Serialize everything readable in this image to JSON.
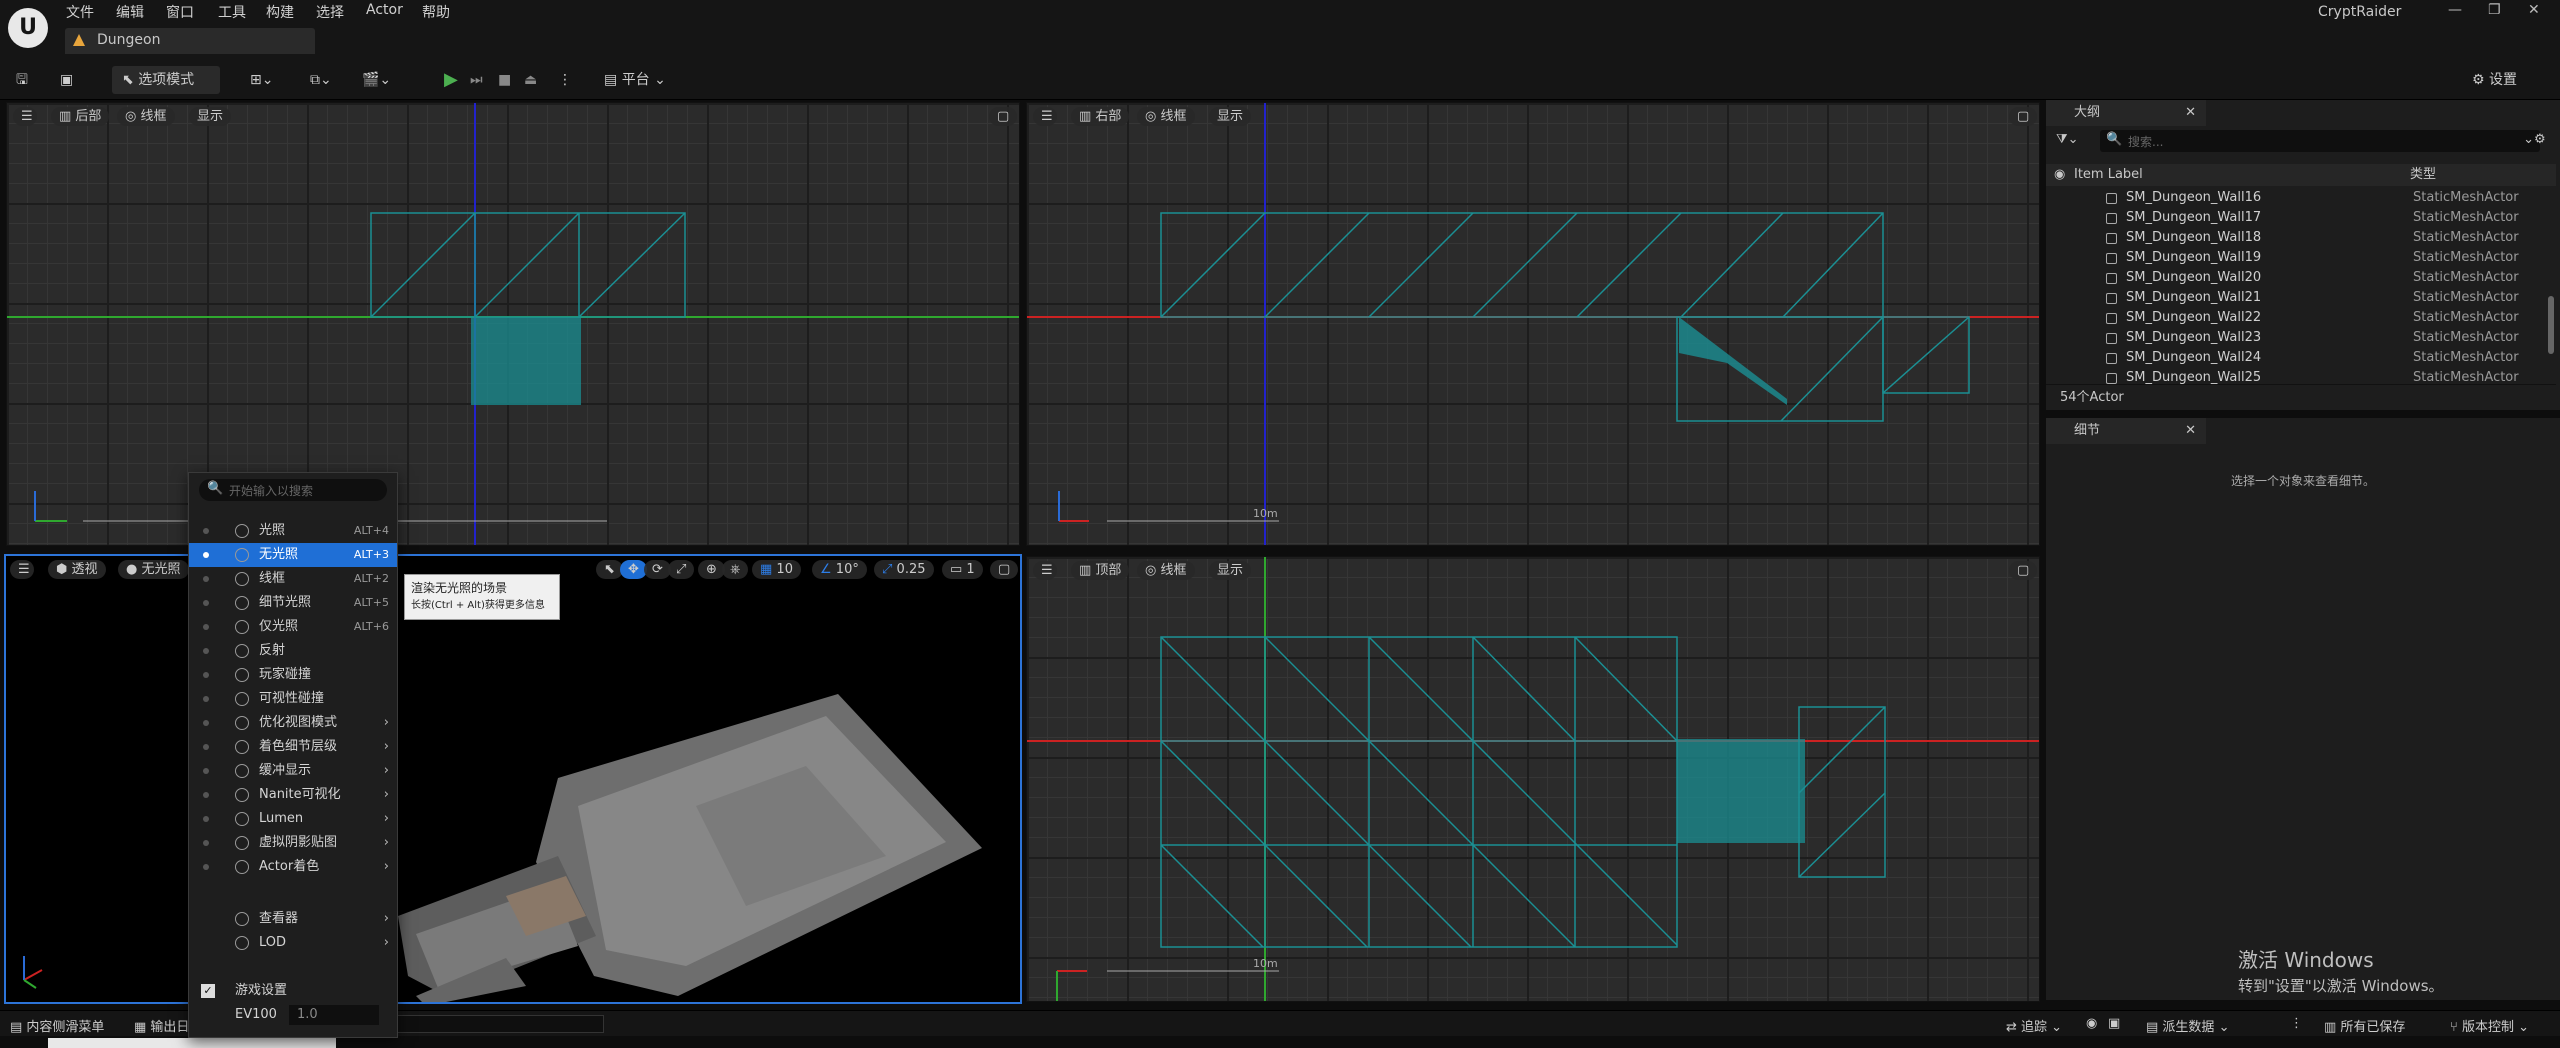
{
  "menubar": {
    "items": [
      "文件",
      "编辑",
      "窗口",
      "工具",
      "构建",
      "选择",
      "Actor",
      "帮助"
    ],
    "doc_tab": "Dungeon",
    "app_title": "CryptRaider"
  },
  "toolbar": {
    "select_mode": "选项模式",
    "platform": "平台",
    "settings": "设置"
  },
  "viewports": {
    "back": {
      "view": "后部",
      "mode": "线框",
      "show": "显示"
    },
    "right": {
      "view": "右部",
      "mode": "线框",
      "show": "显示",
      "scale": "10m"
    },
    "persp": {
      "view": "透视",
      "mode": "无光照",
      "grid": "10",
      "angle": "10°",
      "scale": "0.25",
      "cam": "1"
    },
    "top": {
      "view": "顶部",
      "mode": "线框",
      "show": "显示",
      "scale": "10m"
    }
  },
  "outliner": {
    "tab": "大纲",
    "search_placeholder": "搜索...",
    "col_label": "Item Label",
    "col_type": "类型",
    "rows": [
      {
        "label": "SM_Dungeon_Wall16",
        "type": "StaticMeshActor"
      },
      {
        "label": "SM_Dungeon_Wall17",
        "type": "StaticMeshActor"
      },
      {
        "label": "SM_Dungeon_Wall18",
        "type": "StaticMeshActor"
      },
      {
        "label": "SM_Dungeon_Wall19",
        "type": "StaticMeshActor"
      },
      {
        "label": "SM_Dungeon_Wall20",
        "type": "StaticMeshActor"
      },
      {
        "label": "SM_Dungeon_Wall21",
        "type": "StaticMeshActor"
      },
      {
        "label": "SM_Dungeon_Wall22",
        "type": "StaticMeshActor"
      },
      {
        "label": "SM_Dungeon_Wall23",
        "type": "StaticMeshActor"
      },
      {
        "label": "SM_Dungeon_Wall24",
        "type": "StaticMeshActor"
      },
      {
        "label": "SM_Dungeon_Wall25",
        "type": "StaticMeshActor"
      }
    ],
    "count": "54个Actor"
  },
  "details": {
    "tab": "细节",
    "empty": "选择一个对象来查看细节。"
  },
  "viewmenu": {
    "search_placeholder": "开始输入以搜索",
    "items": [
      {
        "label": "光照",
        "key": "ALT+4"
      },
      {
        "label": "无光照",
        "key": "ALT+3"
      },
      {
        "label": "线框",
        "key": "ALT+2"
      },
      {
        "label": "细节光照",
        "key": "ALT+5"
      },
      {
        "label": "仅光照",
        "key": "ALT+6"
      },
      {
        "label": "反射",
        "key": ""
      },
      {
        "label": "玩家碰撞",
        "key": ""
      },
      {
        "label": "可视性碰撞",
        "key": ""
      },
      {
        "label": "优化视图模式",
        "key": "›"
      },
      {
        "label": "着色细节层级",
        "key": "›"
      },
      {
        "label": "缓冲显示",
        "key": "›"
      },
      {
        "label": "Nanite可视化",
        "key": "›"
      },
      {
        "label": "Lumen",
        "key": "›"
      },
      {
        "label": "虚拟阴影贴图",
        "key": "›"
      },
      {
        "label": "Actor着色",
        "key": "›"
      }
    ],
    "viewers": "查看器",
    "lod": "LOD",
    "game_settings": "游戏设置",
    "ev_label": "EV100",
    "ev_value": "1.0"
  },
  "tooltip": {
    "title": "渲染无光照的场景",
    "hint": "长按(Ctrl + Alt)获得更多信息"
  },
  "statusbar": {
    "content_drawer": "内容侧滑菜单",
    "output_log": "输出日",
    "trace": "追踪",
    "derived_data": "派生数据",
    "all_saved": "所有已保存",
    "source_control": "版本控制"
  },
  "windows_watermark": {
    "line1": "激活 Windows",
    "line2": "转到\"设置\"以激活 Windows。"
  }
}
